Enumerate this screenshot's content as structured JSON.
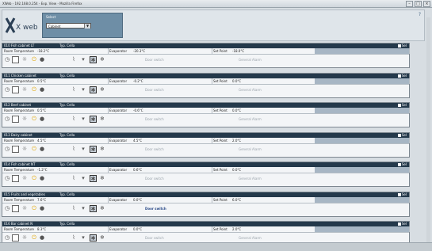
{
  "window": {
    "title": "XWeb - 192.168.0.254 - Exp. View - Mozilla Firefox",
    "help": "?"
  },
  "header": {
    "logo_text": "X web",
    "select_label": "Select",
    "select_value": "Cabinet"
  },
  "labels": {
    "type": "Typ. Cella",
    "room": "Room Temperature",
    "evap": "Evaporator",
    "setpoint": "Set Point",
    "select": "Sel"
  },
  "panels": [
    {
      "name": "010 Fish cabinet LT",
      "room": "-18.2°C",
      "evap": "-20.3°C",
      "setpoint": "-18.0°C",
      "s1": "Door switch",
      "s2": "General Alarm",
      "door": false
    },
    {
      "name": "011 Chicken cabinet",
      "room": "0.5°C",
      "evap": "-0.2°C",
      "setpoint": "0.0°C",
      "s1": "Door switch",
      "s2": "General Alarm",
      "door": false
    },
    {
      "name": "012 Beef cabinet",
      "room": "0.5°C",
      "evap": "-0.6°C",
      "setpoint": "0.0°C",
      "s1": "Door switch",
      "s2": "General Alarm",
      "door": false
    },
    {
      "name": "013 Dairy cabinet",
      "room": "4.5°C",
      "evap": "4.5°C",
      "setpoint": "2.0°C",
      "s1": "Door switch",
      "s2": "General Alarm",
      "door": false
    },
    {
      "name": "014 Fish cabinet NT",
      "room": "-1.2°C",
      "evap": "0.6°C",
      "setpoint": "0.0°C",
      "s1": "Door switch",
      "s2": "General Alarm",
      "door": false
    },
    {
      "name": "015 Fruits and vegetables",
      "room": "7.6°C",
      "evap": "0.0°C",
      "setpoint": "6.0°C",
      "s1": "Door switch",
      "s2": "",
      "door": true
    },
    {
      "name": "016 Bar cabinet N",
      "room": "8.3°C",
      "evap": "0.0°C",
      "setpoint": "2.0°C",
      "s1": "Door switch",
      "s2": "General Alarm",
      "door": false
    }
  ]
}
